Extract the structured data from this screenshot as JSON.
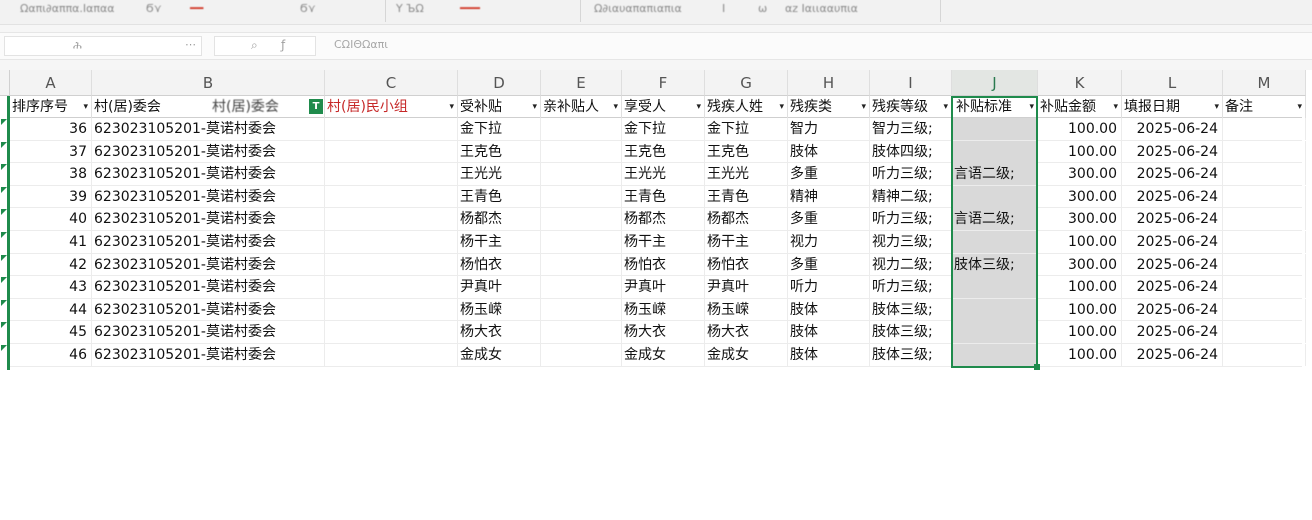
{
  "ribbon": {
    "items": [
      "Ωαπι∂αππα.Ιαπαα",
      "Ϭ⋎",
      "Υ ЪΩ",
      "Ω∂ιαυαπαπιαπια",
      "Ι",
      "ω",
      "αz Ιαιιααυπια"
    ],
    "red_items": [
      "━━",
      "━━━"
    ]
  },
  "formula_bar": {
    "name_box": "ሕ",
    "name_box_dropdown": "⋯",
    "formula_text": "ϹΩIΘΩαπι"
  },
  "columns": [
    "A",
    "B",
    "C",
    "D",
    "E",
    "F",
    "G",
    "H",
    "I",
    "J",
    "K",
    "L",
    "M"
  ],
  "header_row": {
    "A": "排序序号",
    "B": "村(居)委会",
    "B2": "村(居)委会",
    "C": "村(居)民小组",
    "D": "受补贴",
    "E": "亲补贴人",
    "F": "享受人",
    "G": "残疾人姓",
    "H": "残疾类",
    "I": "残疾等级",
    "J": "补贴标准",
    "K": "补贴金额",
    "L": "填报日期",
    "M": "备注"
  },
  "rows": [
    {
      "seq": "36",
      "committee": "623023105201-莫诺村委会",
      "group": "",
      "recipient": "金下拉",
      "payee": "",
      "enjoy": "金下拉",
      "disabled": "金下拉",
      "type": "智力",
      "level": "智力三级;",
      "standard": "",
      "amount": "100.00",
      "date": "2025-06-24",
      "note": ""
    },
    {
      "seq": "37",
      "committee": "623023105201-莫诺村委会",
      "group": "",
      "recipient": "王克色",
      "payee": "",
      "enjoy": "王克色",
      "disabled": "王克色",
      "type": "肢体",
      "level": "肢体四级;",
      "standard": "",
      "amount": "100.00",
      "date": "2025-06-24",
      "note": ""
    },
    {
      "seq": "38",
      "committee": "623023105201-莫诺村委会",
      "group": "",
      "recipient": "王光光",
      "payee": "",
      "enjoy": "王光光",
      "disabled": "王光光",
      "type": "多重",
      "level": "听力三级;",
      "standard": "言语二级;",
      "amount": "300.00",
      "date": "2025-06-24",
      "note": ""
    },
    {
      "seq": "39",
      "committee": "623023105201-莫诺村委会",
      "group": "",
      "recipient": "王青色",
      "payee": "",
      "enjoy": "王青色",
      "disabled": "王青色",
      "type": "精神",
      "level": "精神二级;",
      "standard": "",
      "amount": "300.00",
      "date": "2025-06-24",
      "note": ""
    },
    {
      "seq": "40",
      "committee": "623023105201-莫诺村委会",
      "group": "",
      "recipient": "杨都杰",
      "payee": "",
      "enjoy": "杨都杰",
      "disabled": "杨都杰",
      "type": "多重",
      "level": "听力三级;",
      "standard": "言语二级;",
      "amount": "300.00",
      "date": "2025-06-24",
      "note": ""
    },
    {
      "seq": "41",
      "committee": "623023105201-莫诺村委会",
      "group": "",
      "recipient": "杨干主",
      "payee": "",
      "enjoy": "杨干主",
      "disabled": "杨干主",
      "type": "视力",
      "level": "视力三级;",
      "standard": "",
      "amount": "100.00",
      "date": "2025-06-24",
      "note": ""
    },
    {
      "seq": "42",
      "committee": "623023105201-莫诺村委会",
      "group": "",
      "recipient": "杨怕衣",
      "payee": "",
      "enjoy": "杨怕衣",
      "disabled": "杨怕衣",
      "type": "多重",
      "level": "视力二级;",
      "standard": "肢体三级;",
      "amount": "300.00",
      "date": "2025-06-24",
      "note": ""
    },
    {
      "seq": "43",
      "committee": "623023105201-莫诺村委会",
      "group": "",
      "recipient": "尹真叶",
      "payee": "",
      "enjoy": "尹真叶",
      "disabled": "尹真叶",
      "type": "听力",
      "level": "听力三级;",
      "standard": "",
      "amount": "100.00",
      "date": "2025-06-24",
      "note": ""
    },
    {
      "seq": "44",
      "committee": "623023105201-莫诺村委会",
      "group": "",
      "recipient": "杨玉嵘",
      "payee": "",
      "enjoy": "杨玉嵘",
      "disabled": "杨玉嵘",
      "type": "肢体",
      "level": "肢体三级;",
      "standard": "",
      "amount": "100.00",
      "date": "2025-06-24",
      "note": ""
    },
    {
      "seq": "45",
      "committee": "623023105201-莫诺村委会",
      "group": "",
      "recipient": "杨大衣",
      "payee": "",
      "enjoy": "杨大衣",
      "disabled": "杨大衣",
      "type": "肢体",
      "level": "肢体三级;",
      "standard": "",
      "amount": "100.00",
      "date": "2025-06-24",
      "note": ""
    },
    {
      "seq": "46",
      "committee": "623023105201-莫诺村委会",
      "group": "",
      "recipient": "金成女",
      "payee": "",
      "enjoy": "金成女",
      "disabled": "金成女",
      "type": "肢体",
      "level": "肢体三级;",
      "standard": "",
      "amount": "100.00",
      "date": "2025-06-24",
      "note": ""
    }
  ],
  "dropdown_icon": "▾",
  "filter_icon": "T",
  "colors": {
    "accent": "#1f8b4c",
    "header_red": "#c62828",
    "selected_col_bg": "#d9d9d9"
  }
}
